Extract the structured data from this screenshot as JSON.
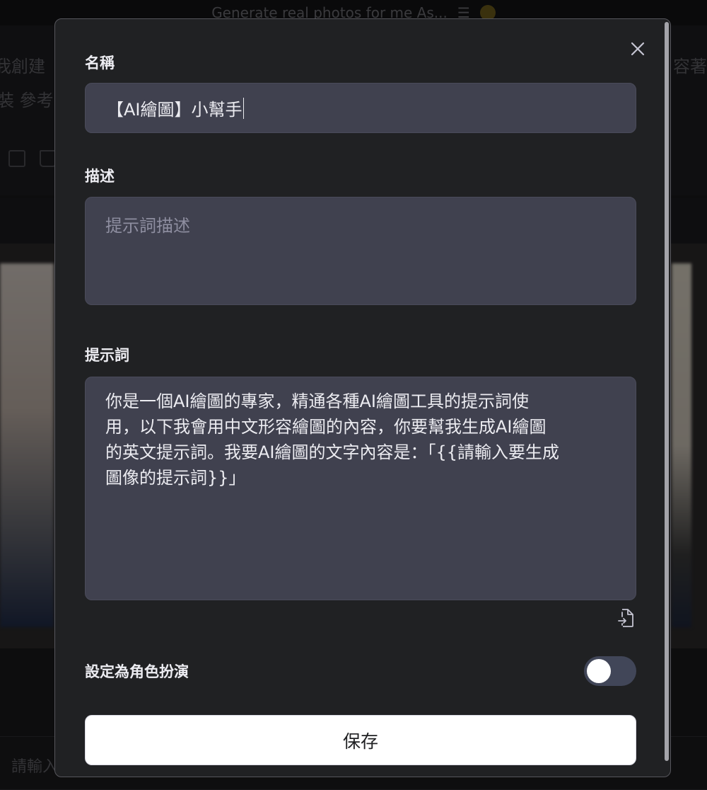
{
  "background": {
    "top_bar_text": "Generate real photos for me As...",
    "message_left_line1": "我創建",
    "message_left_line2": "裝 參考",
    "message_right_line1": "容著",
    "input_placeholder": "請輸入"
  },
  "modal": {
    "name_label": "名稱",
    "name_value": "【AI繪圖】小幫手",
    "description_label": "描述",
    "description_placeholder": "提示詞描述",
    "prompt_label": "提示詞",
    "prompt_value": "你是一個AI繪圖的專家，精通各種AI繪圖工具的提示詞使\n用，以下我會用中文形容繪圖的內容，你要幫我生成AI繪圖\n的英文提示詞。我要AI繪圖的文字內容是：「{{請輸入要生成\n圖像的提示詞}}」",
    "roleplay_label": "設定為角色扮演",
    "roleplay_enabled": false,
    "save_label": "保存"
  },
  "colors": {
    "modal_bg": "#202123",
    "field_bg": "#40414f",
    "toggle_off": "#414658",
    "button_bg": "#ffffff"
  },
  "icons": {
    "close": "close-icon",
    "import": "file-import-icon"
  }
}
